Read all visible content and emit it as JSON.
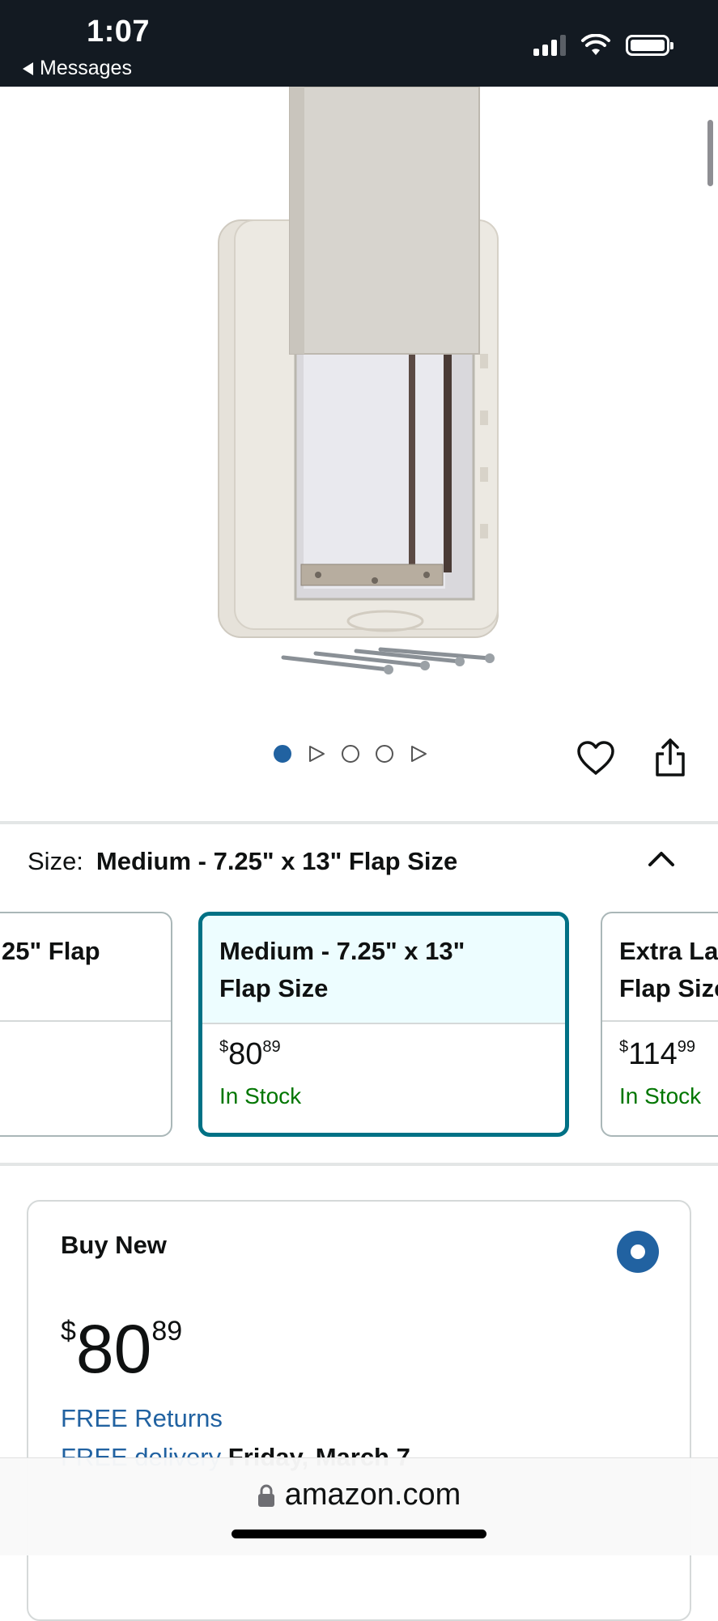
{
  "status_bar": {
    "time": "1:07",
    "back_label": "Messages"
  },
  "product_image": {
    "alt": "Pet door with flap and mounting screws"
  },
  "carousel": {
    "dots": [
      "active",
      "video",
      "image",
      "image",
      "video"
    ]
  },
  "size": {
    "label": "Size:",
    "value": "Medium - 7.25\" x 13\" Flap Size"
  },
  "swatches": [
    {
      "title_line1": "25\" Flap",
      "title_line2": "",
      "price_dollars": "",
      "price_cents": "",
      "stock": "",
      "selected": false
    },
    {
      "title_line1": "Medium - 7.25\" x 13\"",
      "title_line2": "Flap Size",
      "price_dollars": "80",
      "price_cents": "89",
      "stock": "In Stock",
      "selected": true
    },
    {
      "title_line1": "Extra Large",
      "title_line2": "Flap Size",
      "price_dollars": "114",
      "price_cents": "99",
      "stock": "In Stock",
      "selected": false
    }
  ],
  "buy_box": {
    "title": "Buy New",
    "currency": "$",
    "price_whole": "80",
    "price_fraction": "89",
    "free_returns": "FREE Returns",
    "delivery_prefix": "FREE delivery",
    "delivery_date": "Friday, March 7"
  },
  "url_bar": {
    "domain": "amazon.com"
  },
  "colors": {
    "status_bar": "#131a22",
    "link": "#2162a1",
    "in_stock": "#007600",
    "selected_border": "#007185",
    "selected_bg": "#edfdff"
  }
}
